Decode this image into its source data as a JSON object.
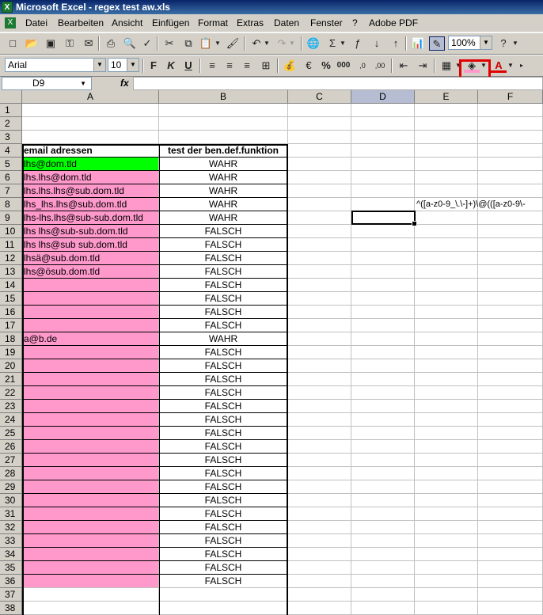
{
  "app": {
    "title": "Microsoft Excel - regex test aw.xls",
    "icon": "excel-icon"
  },
  "menu": [
    "Datei",
    "Bearbeiten",
    "Ansicht",
    "Einfügen",
    "Format",
    "Extras",
    "Daten",
    "Fenster",
    "?",
    "Adobe PDF"
  ],
  "toolbar": {
    "zoom": "100%",
    "font": "Arial",
    "size": "10",
    "bold": "F",
    "italic": "K",
    "underline": "U",
    "euro": "€",
    "percent": "%",
    "thousands": "000"
  },
  "formula_bar": {
    "name_box": "D9",
    "fx": "fx",
    "value": ""
  },
  "columns": [
    "A",
    "B",
    "C",
    "D",
    "E",
    "F"
  ],
  "selected_column": "D",
  "rows": [
    {
      "n": "1",
      "a": "",
      "b": ""
    },
    {
      "n": "2",
      "a": "",
      "b": ""
    },
    {
      "n": "3",
      "a": "",
      "b": ""
    },
    {
      "n": "4",
      "a": "email adressen",
      "b": "test der ben.def.funktion",
      "header": true
    },
    {
      "n": "5",
      "a": "lhs@dom.tld",
      "b": "WAHR",
      "fill": "green"
    },
    {
      "n": "6",
      "a": "lhs.lhs@dom.tld",
      "b": "WAHR",
      "fill": "pink"
    },
    {
      "n": "7",
      "a": "lhs.lhs.lhs@sub.dom.tld",
      "b": "WAHR",
      "fill": "pink"
    },
    {
      "n": "8",
      "a": "lhs_lhs.lhs@sub.dom.tld",
      "b": "WAHR",
      "fill": "pink"
    },
    {
      "n": "9",
      "a": "lhs-lhs.lhs@sub-sub.dom.tld",
      "b": "WAHR",
      "fill": "pink"
    },
    {
      "n": "10",
      "a": "lhs lhs@sub-sub.dom.tld",
      "b": "FALSCH",
      "fill": "pink"
    },
    {
      "n": "11",
      "a": "lhs lhs@sub sub.dom.tld",
      "b": "FALSCH",
      "fill": "pink"
    },
    {
      "n": "12",
      "a": "lhsä@sub.dom.tld",
      "b": "FALSCH",
      "fill": "pink"
    },
    {
      "n": "13",
      "a": "lhs@ösub.dom.tld",
      "b": "FALSCH",
      "fill": "pink"
    },
    {
      "n": "14",
      "a": "",
      "b": "FALSCH",
      "fill": "pink"
    },
    {
      "n": "15",
      "a": "",
      "b": "FALSCH",
      "fill": "pink"
    },
    {
      "n": "16",
      "a": "",
      "b": "FALSCH",
      "fill": "pink"
    },
    {
      "n": "17",
      "a": "",
      "b": "FALSCH",
      "fill": "pink"
    },
    {
      "n": "18",
      "a": "a@b.de",
      "b": "WAHR",
      "fill": "pink"
    },
    {
      "n": "19",
      "a": "",
      "b": "FALSCH",
      "fill": "pink"
    },
    {
      "n": "20",
      "a": "",
      "b": "FALSCH",
      "fill": "pink"
    },
    {
      "n": "21",
      "a": "",
      "b": "FALSCH",
      "fill": "pink"
    },
    {
      "n": "22",
      "a": "",
      "b": "FALSCH",
      "fill": "pink"
    },
    {
      "n": "23",
      "a": "",
      "b": "FALSCH",
      "fill": "pink"
    },
    {
      "n": "24",
      "a": "",
      "b": "FALSCH",
      "fill": "pink"
    },
    {
      "n": "25",
      "a": "",
      "b": "FALSCH",
      "fill": "pink"
    },
    {
      "n": "26",
      "a": "",
      "b": "FALSCH",
      "fill": "pink"
    },
    {
      "n": "27",
      "a": "",
      "b": "FALSCH",
      "fill": "pink"
    },
    {
      "n": "28",
      "a": "",
      "b": "FALSCH",
      "fill": "pink"
    },
    {
      "n": "29",
      "a": "",
      "b": "FALSCH",
      "fill": "pink"
    },
    {
      "n": "30",
      "a": "",
      "b": "FALSCH",
      "fill": "pink"
    },
    {
      "n": "31",
      "a": "",
      "b": "FALSCH",
      "fill": "pink"
    },
    {
      "n": "32",
      "a": "",
      "b": "FALSCH",
      "fill": "pink"
    },
    {
      "n": "33",
      "a": "",
      "b": "FALSCH",
      "fill": "pink"
    },
    {
      "n": "34",
      "a": "",
      "b": "FALSCH",
      "fill": "pink"
    },
    {
      "n": "35",
      "a": "",
      "b": "FALSCH",
      "fill": "pink"
    },
    {
      "n": "36",
      "a": "",
      "b": "FALSCH",
      "fill": "pink"
    },
    {
      "n": "37",
      "a": "",
      "b": ""
    },
    {
      "n": "38",
      "a": "",
      "b": ""
    }
  ],
  "cell_e8": "^([a-z0-9_\\.\\-]+)\\@(([a-z0-9\\-",
  "colors": {
    "pink": "#ff99cc",
    "green": "#00ff00",
    "highlight": "#e00000"
  }
}
